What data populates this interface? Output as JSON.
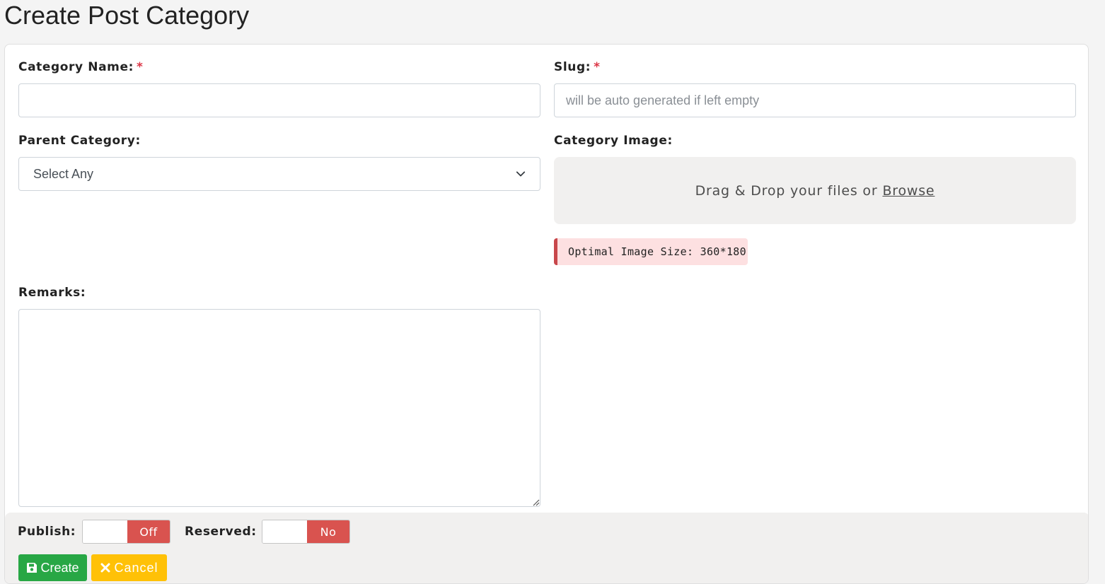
{
  "page": {
    "title": "Create Post Category"
  },
  "form": {
    "category_name": {
      "label": "Category Name:",
      "required_mark": "*",
      "value": "",
      "placeholder": ""
    },
    "slug": {
      "label": "Slug:",
      "required_mark": "*",
      "value": "",
      "placeholder": "will be auto generated if left empty"
    },
    "parent_category": {
      "label": "Parent Category:",
      "selected": "Select Any"
    },
    "category_image": {
      "label": "Category Image:",
      "dropzone_text": "Drag & Drop your files or",
      "browse_label": "Browse",
      "hint": "Optimal Image Size: 360*180"
    },
    "remarks": {
      "label": "Remarks:",
      "value": ""
    }
  },
  "footer": {
    "publish": {
      "label": "Publish:",
      "state": "Off"
    },
    "reserved": {
      "label": "Reserved:",
      "state": "No"
    },
    "create_label": "Create",
    "cancel_label": "Cancel"
  },
  "colors": {
    "create": "#28a745",
    "cancel": "#ffc107",
    "toggle_off": "#d9534f",
    "required": "#dc3545",
    "hint_border": "#c8474b",
    "hint_bg": "#fde0e1"
  },
  "icons": {
    "parent_select": "chevron-down-icon",
    "create": "save-icon",
    "cancel": "close-icon",
    "remarks": "resize-handle-icon"
  }
}
